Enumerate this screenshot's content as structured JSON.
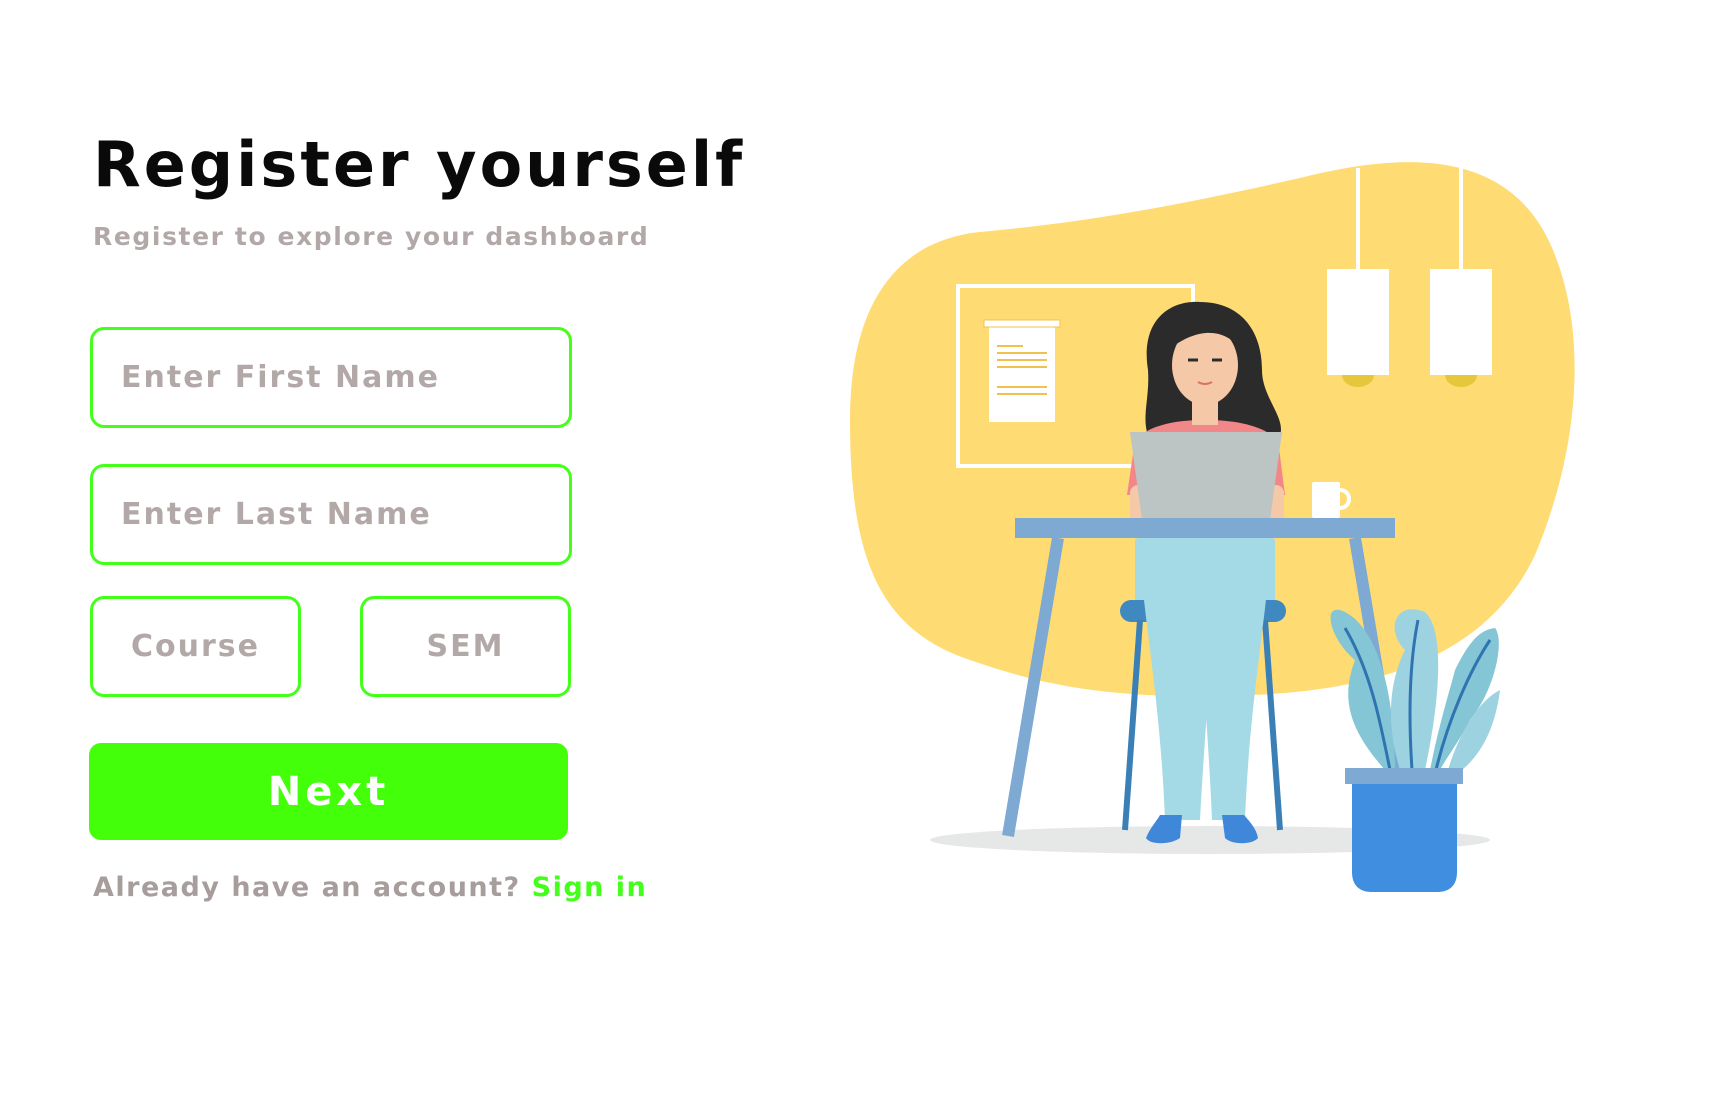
{
  "header": {
    "title": "Register yourself",
    "subtitle": "Register to explore your dashboard"
  },
  "form": {
    "first_name": {
      "placeholder": "Enter First Name",
      "value": ""
    },
    "last_name": {
      "placeholder": "Enter Last Name",
      "value": ""
    },
    "course": {
      "placeholder": "Course",
      "value": ""
    },
    "sem": {
      "placeholder": "SEM",
      "value": ""
    },
    "next_label": "Next"
  },
  "footer": {
    "prompt": "Already have an account?",
    "signin_label": "Sign in"
  },
  "colors": {
    "accent": "#44ff0a",
    "placeholder": "#b3a8a8",
    "title": "#0a0a0a",
    "blob": "#ffdb73"
  }
}
